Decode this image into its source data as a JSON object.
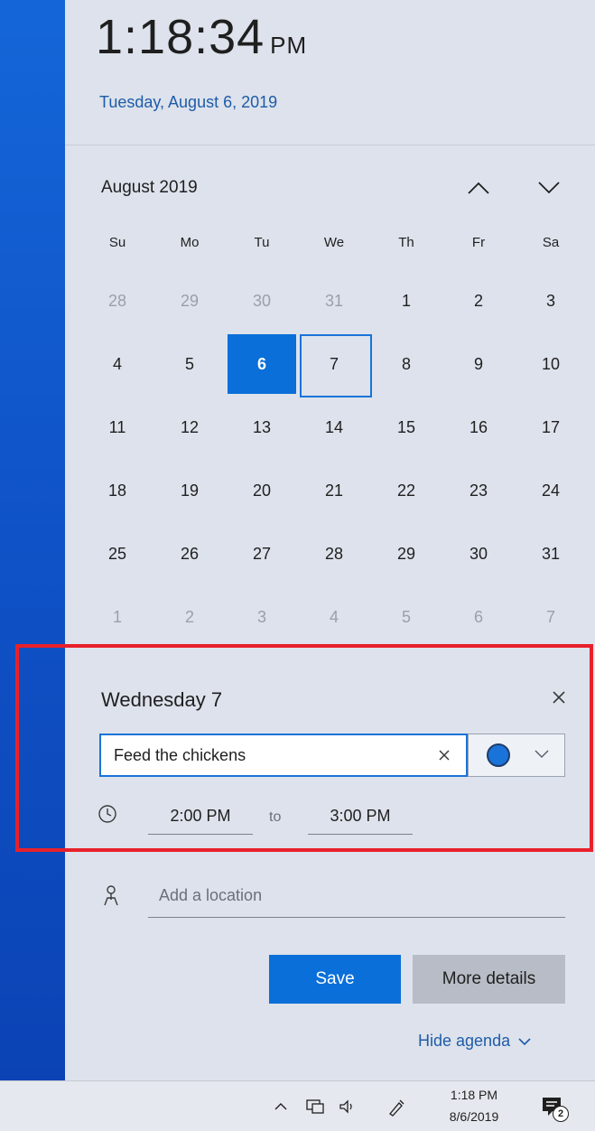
{
  "header": {
    "time": "1:18:34",
    "ampm": "PM",
    "date_link": "Tuesday, August 6, 2019"
  },
  "calendar": {
    "month_title": "August 2019",
    "weekdays": [
      "Su",
      "Mo",
      "Tu",
      "We",
      "Th",
      "Fr",
      "Sa"
    ],
    "days": [
      {
        "label": "28",
        "muted": true
      },
      {
        "label": "29",
        "muted": true
      },
      {
        "label": "30",
        "muted": true
      },
      {
        "label": "31",
        "muted": true
      },
      {
        "label": "1"
      },
      {
        "label": "2"
      },
      {
        "label": "3"
      },
      {
        "label": "4"
      },
      {
        "label": "5"
      },
      {
        "label": "6",
        "today": true
      },
      {
        "label": "7",
        "selected": true
      },
      {
        "label": "8"
      },
      {
        "label": "9"
      },
      {
        "label": "10"
      },
      {
        "label": "11"
      },
      {
        "label": "12"
      },
      {
        "label": "13"
      },
      {
        "label": "14"
      },
      {
        "label": "15"
      },
      {
        "label": "16"
      },
      {
        "label": "17"
      },
      {
        "label": "18"
      },
      {
        "label": "19"
      },
      {
        "label": "20"
      },
      {
        "label": "21"
      },
      {
        "label": "22"
      },
      {
        "label": "23"
      },
      {
        "label": "24"
      },
      {
        "label": "25"
      },
      {
        "label": "26"
      },
      {
        "label": "27"
      },
      {
        "label": "28"
      },
      {
        "label": "29"
      },
      {
        "label": "30"
      },
      {
        "label": "31"
      },
      {
        "label": "1",
        "muted": true
      },
      {
        "label": "2",
        "muted": true
      },
      {
        "label": "3",
        "muted": true
      },
      {
        "label": "4",
        "muted": true
      },
      {
        "label": "5",
        "muted": true
      },
      {
        "label": "6",
        "muted": true
      },
      {
        "label": "7",
        "muted": true
      }
    ]
  },
  "event": {
    "title": "Wednesday 7",
    "name_value": "Feed the chickens",
    "color": "#1a73d9",
    "start_time": "2:00 PM",
    "to_label": "to",
    "end_time": "3:00 PM",
    "location_placeholder": "Add a location",
    "save_label": "Save",
    "more_details_label": "More details",
    "hide_agenda_label": "Hide agenda"
  },
  "taskbar": {
    "time": "1:18 PM",
    "date": "8/6/2019",
    "notification_count": "2"
  },
  "colors": {
    "accent": "#0a6fd8",
    "highlight_box": "#e8202a",
    "link": "#1e5ca8"
  }
}
